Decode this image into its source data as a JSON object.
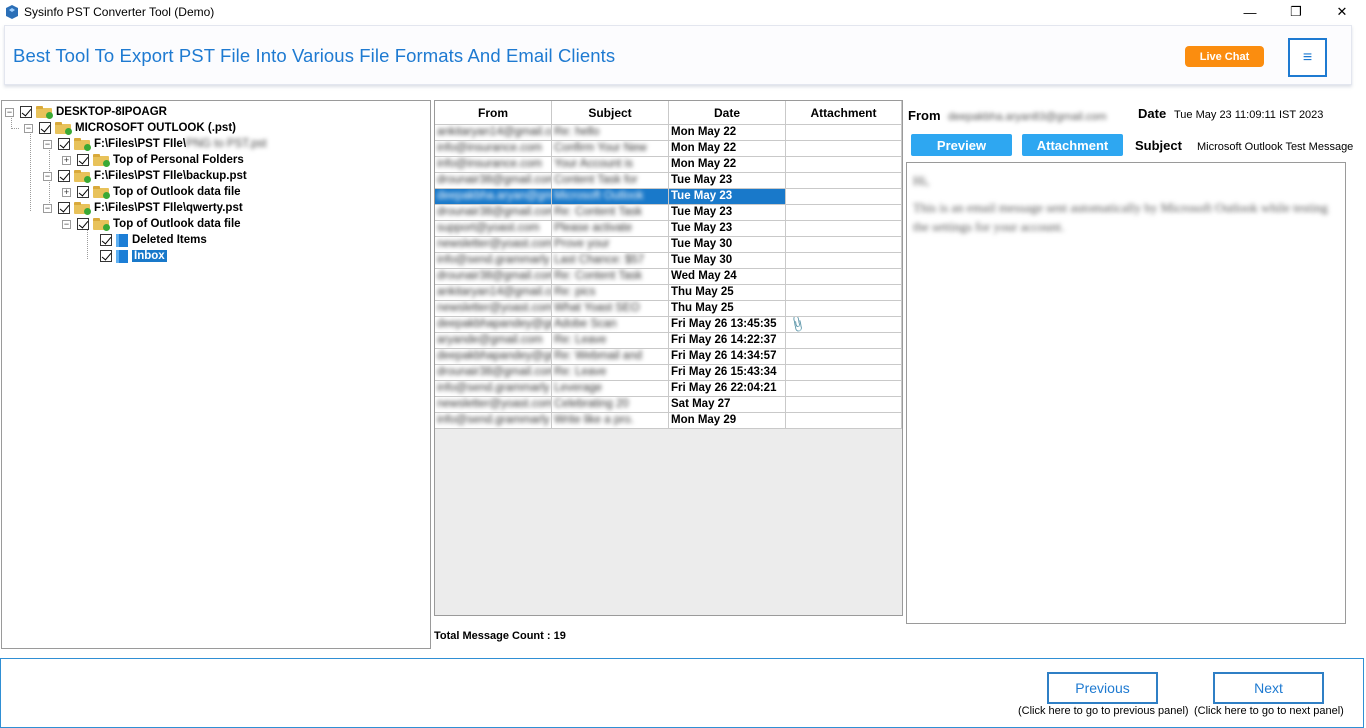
{
  "window": {
    "title": "Sysinfo PST Converter Tool (Demo)",
    "minimize": "—",
    "restore": "❐",
    "close": "✕"
  },
  "header": {
    "headline": "Best Tool To Export PST File Into Various File Formats And Email Clients",
    "live_chat": "Live Chat",
    "menu_icon": "≡"
  },
  "tree": {
    "nodes": [
      {
        "label": "DESKTOP-8IPOAGR"
      },
      {
        "label": "MICROSOFT OUTLOOK (.pst)"
      },
      {
        "label": "F:\\Files\\PST FIle\\",
        "blur": "PNG to PST.pst"
      },
      {
        "label": "Top of Personal Folders"
      },
      {
        "label": "F:\\Files\\PST FIle\\backup.pst"
      },
      {
        "label": "Top of Outlook data file"
      },
      {
        "label": "F:\\Files\\PST FIle\\qwerty.pst"
      },
      {
        "label": "Top of Outlook data file"
      },
      {
        "label": "Deleted Items"
      },
      {
        "label": "Inbox"
      }
    ]
  },
  "grid": {
    "columns": [
      "From",
      "Subject",
      "Date",
      "Attachment"
    ],
    "rows": [
      {
        "from": "ankitaryan14@gmail.com",
        "subject": "Re: hello",
        "date": "Mon May 22",
        "attach": ""
      },
      {
        "from": "info@insurance.com",
        "subject": "Confirm Your New",
        "date": "Mon May 22",
        "attach": ""
      },
      {
        "from": "info@insurance.com",
        "subject": "Your Account is",
        "date": "Mon May 22",
        "attach": ""
      },
      {
        "from": "drounair38@gmail.com",
        "subject": "Content Task for",
        "date": "Tue May 23",
        "attach": ""
      },
      {
        "from": "deepakbha.aryan@gmail",
        "subject": "Microsoft Outlook",
        "date": "Tue May 23",
        "attach": ""
      },
      {
        "from": "drounair38@gmail.com",
        "subject": "Re: Content Task",
        "date": "Tue May 23",
        "attach": ""
      },
      {
        "from": "support@yoast.com",
        "subject": "Please activate",
        "date": "Tue May 23",
        "attach": ""
      },
      {
        "from": "newsletter@yoast.com",
        "subject": "Prove your",
        "date": "Tue May 30",
        "attach": ""
      },
      {
        "from": "info@send.grammarly",
        "subject": "Last Chance: $57",
        "date": "Tue May 30",
        "attach": ""
      },
      {
        "from": "drounair38@gmail.com",
        "subject": "Re: Content Task",
        "date": "Wed May 24",
        "attach": ""
      },
      {
        "from": "ankitaryan14@gmail.com",
        "subject": "Re: pics",
        "date": "Thu May 25",
        "attach": ""
      },
      {
        "from": "newsletter@yoast.com",
        "subject": "What Yoast SEO",
        "date": "Thu May 25",
        "attach": ""
      },
      {
        "from": "deepakbhapandey@gm",
        "subject": "Adobe Scan",
        "date": "Fri May 26 13:45:35",
        "attach": "📎"
      },
      {
        "from": "aryande@gmail.com",
        "subject": "Re: Leave",
        "date": "Fri May 26 14:22:37",
        "attach": ""
      },
      {
        "from": "deepakbhapandey@gm",
        "subject": "Re: Webmail and",
        "date": "Fri May 26 14:34:57",
        "attach": ""
      },
      {
        "from": "drounair38@gmail.com",
        "subject": "Re: Leave",
        "date": "Fri May 26 15:43:34",
        "attach": ""
      },
      {
        "from": "info@send.grammarly",
        "subject": "Leverage",
        "date": "Fri May 26 22:04:21",
        "attach": ""
      },
      {
        "from": "newsletter@yoast.com",
        "subject": "Celebrating 20",
        "date": "Sat May 27",
        "attach": ""
      },
      {
        "from": "info@send.grammarly",
        "subject": "Write like a pro.",
        "date": "Mon May 29",
        "attach": ""
      }
    ],
    "selected_index": 4,
    "total_label": "Total Message Count : 19"
  },
  "preview": {
    "from_label": "From",
    "from_value": "deepakbha.aryan83@gmail.com",
    "date_label": "Date",
    "date_value": "Tue May 23 11:09:11 IST 2023",
    "preview_btn": "Preview",
    "attachment_btn": "Attachment",
    "subject_label": "Subject",
    "subject_value": "Microsoft Outlook Test Message",
    "body_line1": "Hi,",
    "body_line2": "This is an email message sent automatically by Microsoft Outlook while testing the settings for your account."
  },
  "footer": {
    "previous": "Previous",
    "previous_hint": "(Click here to go to previous panel)",
    "next": "Next",
    "next_hint": "(Click here to go to next panel)"
  }
}
